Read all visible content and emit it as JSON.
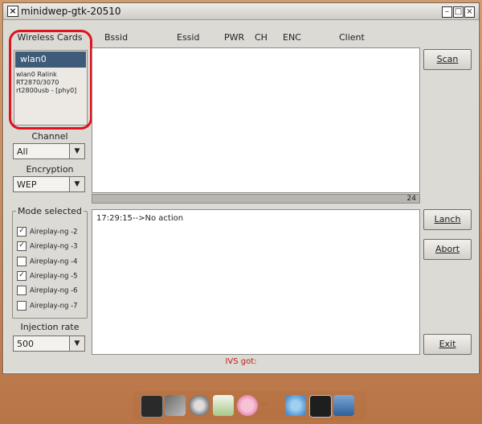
{
  "window": {
    "title": "minidwep-gtk-20510"
  },
  "left": {
    "wireless_label": "Wireless Cards",
    "card_selected": "wlan0",
    "card_desc": "wlan0 Ralink RT2870/3070 rt2800usb - [phy0]",
    "channel_label": "Channel",
    "channel_value": "All",
    "encryption_label": "Encryption",
    "encryption_value": "WEP",
    "mode_label": "Mode selected",
    "modes": [
      {
        "label": "Aireplay-ng -2",
        "checked": "✓"
      },
      {
        "label": "Aireplay-ng -3",
        "checked": "✓"
      },
      {
        "label": "Aireplay-ng -4",
        "checked": ""
      },
      {
        "label": "Aireplay-ng -5",
        "checked": "✓"
      },
      {
        "label": "Aireplay-ng -6",
        "checked": ""
      },
      {
        "label": "Aireplay-ng -7",
        "checked": ""
      }
    ],
    "injection_label": "Injection rate",
    "injection_value": "500"
  },
  "columns": [
    "Bssid",
    "Essid",
    "PWR",
    "CH",
    "ENC",
    "Client"
  ],
  "progress": {
    "value": "24"
  },
  "log": {
    "line": "17:29:15-->No action"
  },
  "buttons": {
    "scan": "Scan",
    "lanch": "Lanch",
    "abort": "Abort",
    "exit": "Exit"
  },
  "status": {
    "ivs": "IVS got:"
  },
  "dock_icons": [
    "terminal-icon",
    "tools-icon",
    "gears-icon",
    "shell-icon",
    "bunny-icon",
    "leafpad-icon",
    "network-icon",
    "console-icon",
    "xfe-icon"
  ]
}
